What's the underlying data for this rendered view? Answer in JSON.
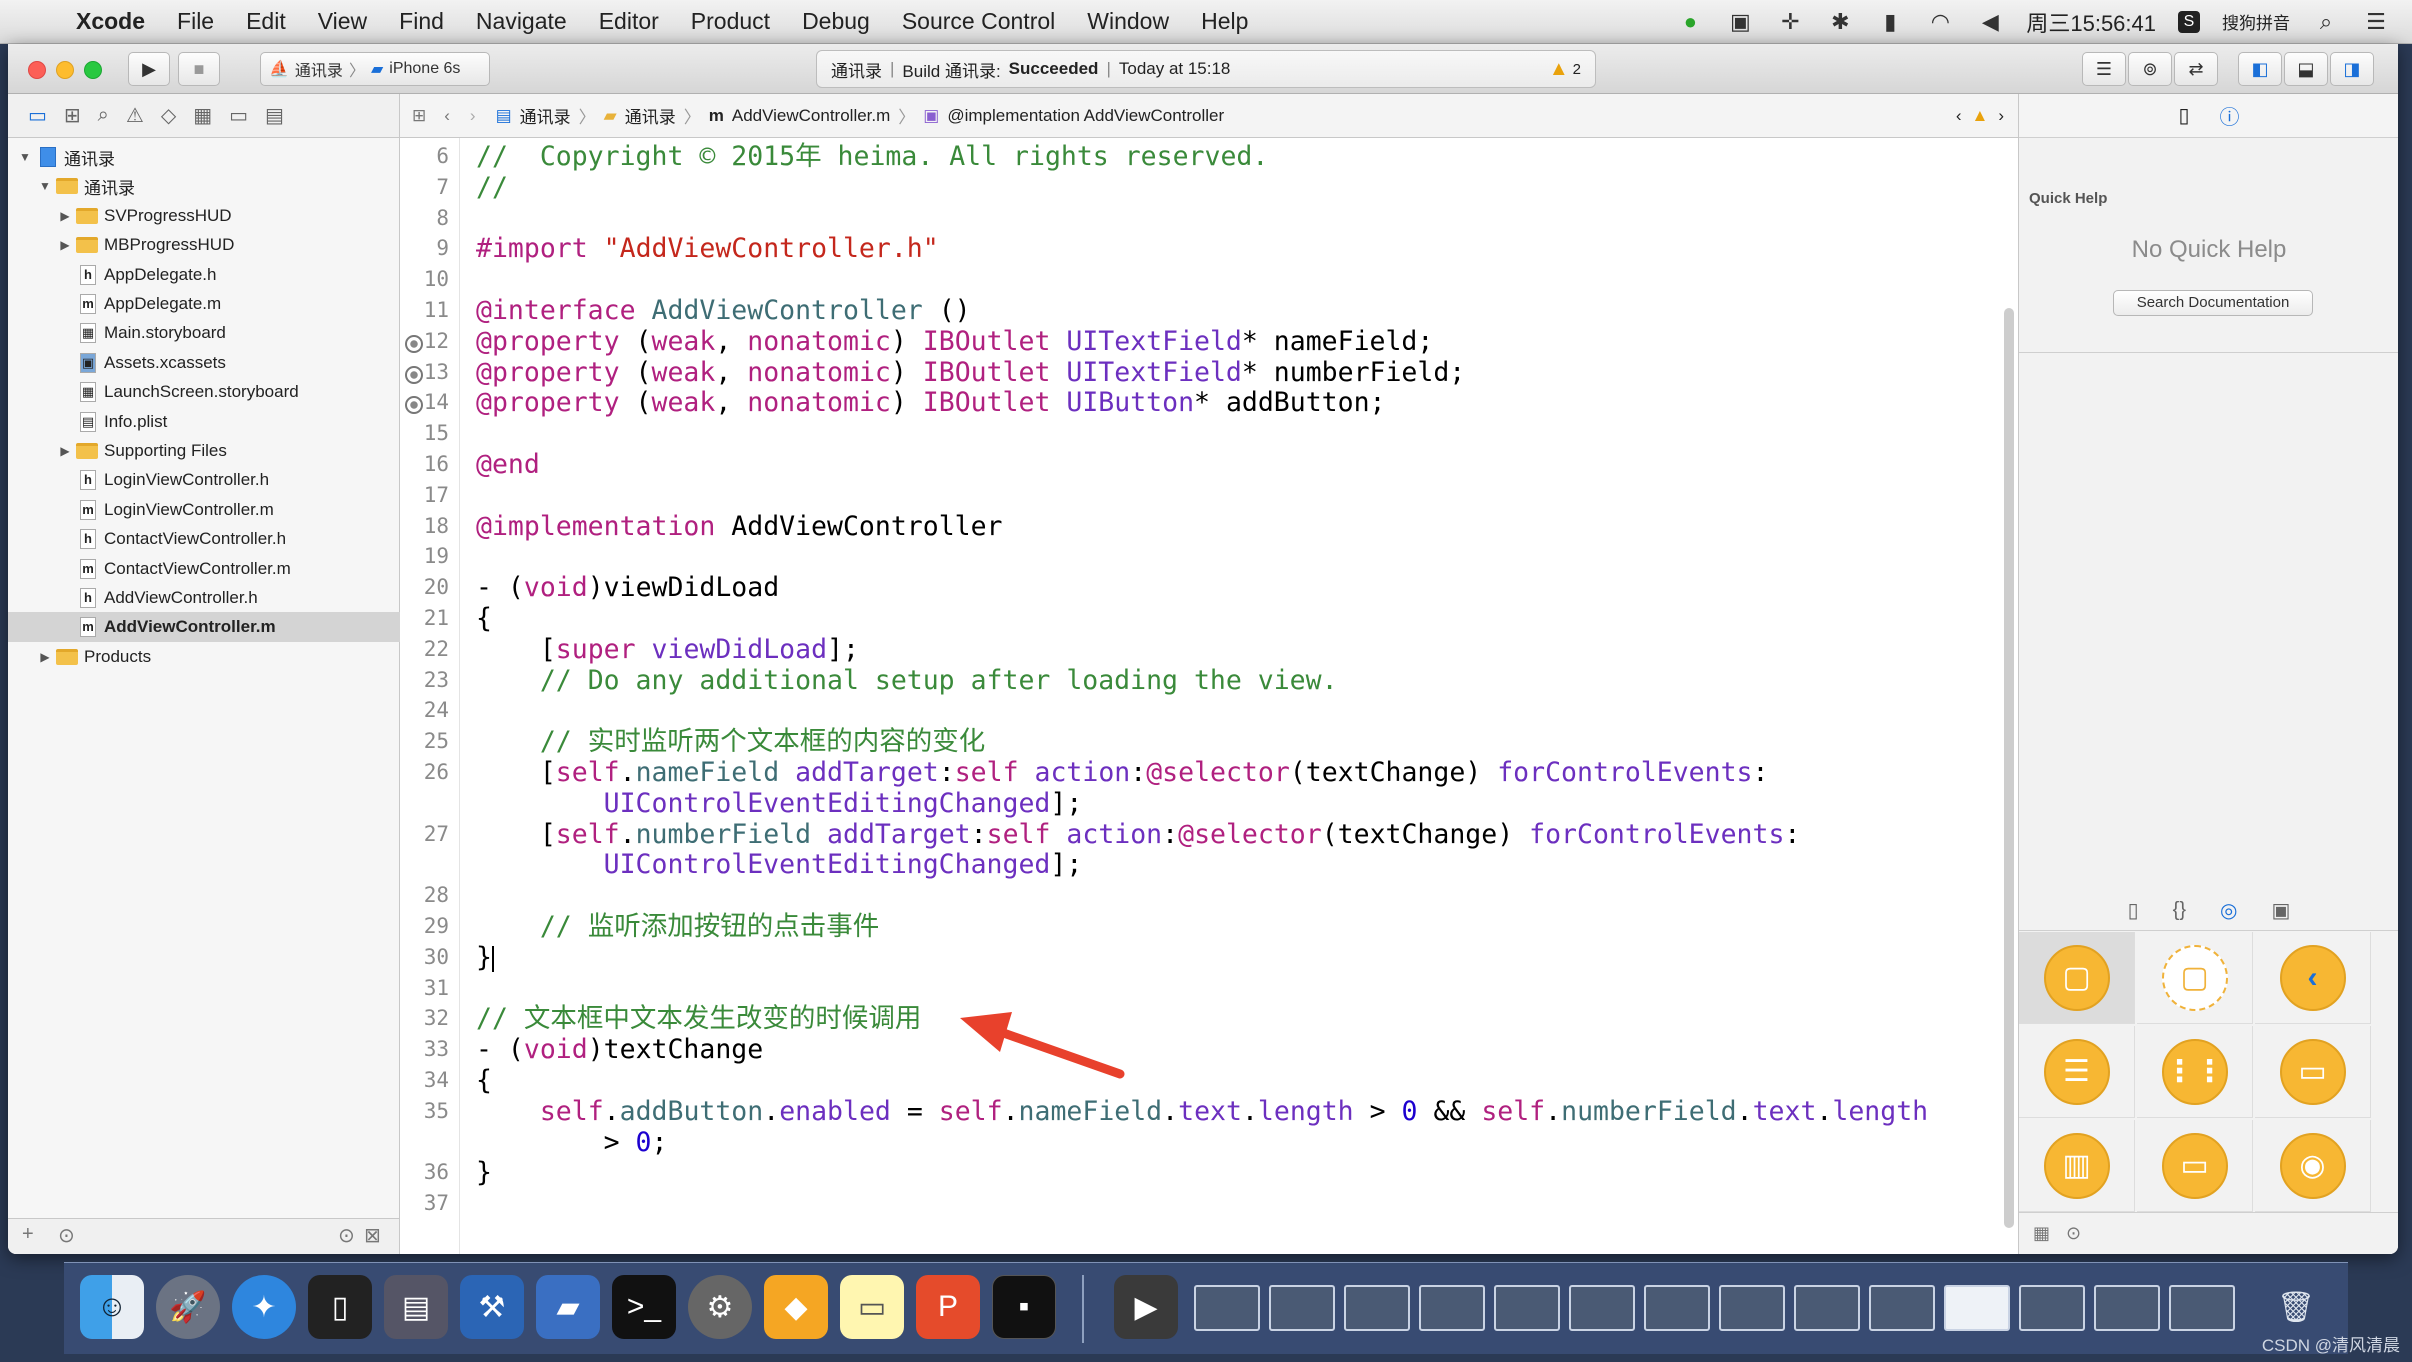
{
  "menubar": {
    "app": "Xcode",
    "items": [
      "File",
      "Edit",
      "View",
      "Find",
      "Navigate",
      "Editor",
      "Product",
      "Debug",
      "Source Control",
      "Window",
      "Help"
    ],
    "clock": "周三15:56:41",
    "input_method": "搜狗拼音"
  },
  "toolbar": {
    "scheme": "通讯录",
    "device": "iPhone 6s",
    "activity_project": "通讯录",
    "activity_build_prefix": "Build 通讯录:",
    "activity_build_status": "Succeeded",
    "activity_time": "Today at 15:18",
    "warning_count": "2"
  },
  "jumpbar": {
    "crumbs": [
      "通讯录",
      "通讯录",
      "AddViewController.m",
      "@implementation AddViewController"
    ]
  },
  "navigator": {
    "items": [
      {
        "label": "通讯录",
        "level": 0,
        "kind": "project",
        "open": true
      },
      {
        "label": "通讯录",
        "level": 1,
        "kind": "folder",
        "open": true
      },
      {
        "label": "SVProgressHUD",
        "level": 2,
        "kind": "folder",
        "open": false
      },
      {
        "label": "MBProgressHUD",
        "level": 2,
        "kind": "folder",
        "open": false
      },
      {
        "label": "AppDelegate.h",
        "level": 2,
        "kind": "h"
      },
      {
        "label": "AppDelegate.m",
        "level": 2,
        "kind": "m"
      },
      {
        "label": "Main.storyboard",
        "level": 2,
        "kind": "sb"
      },
      {
        "label": "Assets.xcassets",
        "level": 2,
        "kind": "assets"
      },
      {
        "label": "LaunchScreen.storyboard",
        "level": 2,
        "kind": "sb"
      },
      {
        "label": "Info.plist",
        "level": 2,
        "kind": "plist"
      },
      {
        "label": "Supporting Files",
        "level": 2,
        "kind": "folder",
        "open": false
      },
      {
        "label": "LoginViewController.h",
        "level": 2,
        "kind": "h"
      },
      {
        "label": "LoginViewController.m",
        "level": 2,
        "kind": "m"
      },
      {
        "label": "ContactViewController.h",
        "level": 2,
        "kind": "h"
      },
      {
        "label": "ContactViewController.m",
        "level": 2,
        "kind": "m"
      },
      {
        "label": "AddViewController.h",
        "level": 2,
        "kind": "h"
      },
      {
        "label": "AddViewController.m",
        "level": 2,
        "kind": "m",
        "selected": true
      },
      {
        "label": "Products",
        "level": 1,
        "kind": "folder",
        "open": false
      }
    ]
  },
  "editor": {
    "lines": [
      {
        "n": "6",
        "html": "<span class='cm'>//  Copyright © 2015年 heima. All rights reserved.</span>"
      },
      {
        "n": "7",
        "html": "<span class='cm'>//</span>"
      },
      {
        "n": "8",
        "html": ""
      },
      {
        "n": "9",
        "html": "<span class='kw'>#import</span> <span class='st'>\"AddViewController.h\"</span>"
      },
      {
        "n": "10",
        "html": ""
      },
      {
        "n": "11",
        "html": "<span class='kw'>@interface</span> <span class='pj'>AddViewController</span> ()"
      },
      {
        "n": "12",
        "bp": true,
        "html": "<span class='kw'>@property</span> (<span class='kw'>weak</span>, <span class='kw'>nonatomic</span>) <span class='kw'>IBOutlet</span> <span class='ty'>UITextField</span>* nameField;"
      },
      {
        "n": "13",
        "bp": true,
        "html": "<span class='kw'>@property</span> (<span class='kw'>weak</span>, <span class='kw'>nonatomic</span>) <span class='kw'>IBOutlet</span> <span class='ty'>UITextField</span>* numberField;"
      },
      {
        "n": "14",
        "bp": true,
        "html": "<span class='kw'>@property</span> (<span class='kw'>weak</span>, <span class='kw'>nonatomic</span>) <span class='kw'>IBOutlet</span> <span class='ty'>UIButton</span>* addButton;"
      },
      {
        "n": "15",
        "html": ""
      },
      {
        "n": "16",
        "html": "<span class='kw'>@end</span>"
      },
      {
        "n": "17",
        "html": ""
      },
      {
        "n": "18",
        "html": "<span class='kw'>@implementation</span> AddViewController"
      },
      {
        "n": "19",
        "html": ""
      },
      {
        "n": "20",
        "html": "- (<span class='kw'>void</span>)viewDidLoad"
      },
      {
        "n": "21",
        "html": "{"
      },
      {
        "n": "22",
        "html": "    [<span class='kw'>super</span> <span class='ty'>viewDidLoad</span>];"
      },
      {
        "n": "23",
        "html": "    <span class='cm'>// Do any additional setup after loading the view.</span>"
      },
      {
        "n": "24",
        "html": ""
      },
      {
        "n": "25",
        "html": "    <span class='cm'>// 实时监听两个文本框的内容的变化</span>"
      },
      {
        "n": "26",
        "html": "    [<span class='kw'>self</span>.<span class='pj'>nameField</span> <span class='ty'>addTarget</span>:<span class='kw'>self</span> <span class='ty'>action</span>:<span class='kw'>@selector</span>(textChange) <span class='ty'>forControlEvents</span>:"
      },
      {
        "n": "",
        "html": "        <span class='ty'>UIControlEventEditingChanged</span>];"
      },
      {
        "n": "27",
        "html": "    [<span class='kw'>self</span>.<span class='pj'>numberField</span> <span class='ty'>addTarget</span>:<span class='kw'>self</span> <span class='ty'>action</span>:<span class='kw'>@selector</span>(textChange) <span class='ty'>forControlEvents</span>:"
      },
      {
        "n": "",
        "html": "        <span class='ty'>UIControlEventEditingChanged</span>];"
      },
      {
        "n": "28",
        "html": ""
      },
      {
        "n": "29",
        "html": "    <span class='cm'>// 监听添加按钮的点击事件</span>"
      },
      {
        "n": "30",
        "html": "}"
      },
      {
        "n": "31",
        "html": ""
      },
      {
        "n": "32",
        "html": "<span class='cm'>// 文本框中文本发生改变的时候调用</span>"
      },
      {
        "n": "33",
        "html": "- (<span class='kw'>void</span>)textChange"
      },
      {
        "n": "34",
        "html": "{"
      },
      {
        "n": "35",
        "html": "    <span class='kw'>self</span>.<span class='pj'>addButton</span>.<span class='ty'>enabled</span> = <span class='kw'>self</span>.<span class='pj'>nameField</span>.<span class='ty'>text</span>.<span class='ty'>length</span> > <span class='nm'>0</span> && <span class='kw'>self</span>.<span class='pj'>numberField</span>.<span class='ty'>text</span>.<span class='ty'>length</span>"
      },
      {
        "n": "",
        "html": "        > <span class='nm'>0</span>;"
      },
      {
        "n": "36",
        "html": "}"
      },
      {
        "n": "37",
        "html": ""
      }
    ]
  },
  "inspector": {
    "quick_help_title": "Quick Help",
    "no_help": "No Quick Help",
    "search_button": "Search Documentation"
  },
  "watermark": "CSDN @清风清晨",
  "colors": {
    "accent": "#1a73e8",
    "library_orange": "#f7b733",
    "annotation_arrow": "#e8412c"
  }
}
